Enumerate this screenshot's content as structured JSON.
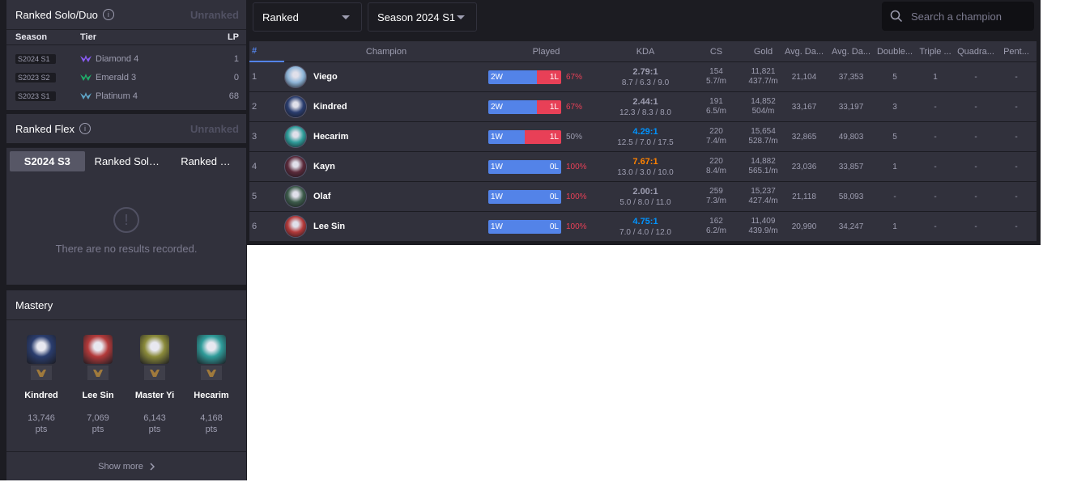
{
  "ranked_solo": {
    "title": "Ranked Solo/Duo",
    "status": "Unranked",
    "headers": {
      "season": "Season",
      "tier": "Tier",
      "lp": "LP"
    },
    "rows": [
      {
        "season": "S2024 S1",
        "tier": "Diamond 4",
        "lp": "1",
        "color": "#8a5cf6"
      },
      {
        "season": "S2023 S2",
        "tier": "Emerald 3",
        "lp": "0",
        "color": "#1fae6a"
      },
      {
        "season": "S2023 S1",
        "tier": "Platinum 4",
        "lp": "68",
        "color": "#5fa6c9"
      }
    ]
  },
  "ranked_flex": {
    "title": "Ranked Flex",
    "status": "Unranked"
  },
  "tabs": {
    "items": [
      "S2024 S3",
      "Ranked Solo/Duo",
      "Ranked Flex"
    ],
    "active_index": 0,
    "empty_icon": "!",
    "empty_text": "There are no results recorded."
  },
  "mastery": {
    "title": "Mastery",
    "items": [
      {
        "name": "Kindred",
        "points": "13,746",
        "unit": "pts",
        "color": "#2a3d6e"
      },
      {
        "name": "Lee Sin",
        "points": "7,069",
        "unit": "pts",
        "color": "#b33a3a"
      },
      {
        "name": "Master Yi",
        "points": "6,143",
        "unit": "pts",
        "color": "#8a8a3a"
      },
      {
        "name": "Hecarim",
        "points": "4,168",
        "unit": "pts",
        "color": "#2f9c9a"
      }
    ],
    "show_more": "Show more"
  },
  "filters": {
    "queue": "Ranked",
    "season": "Season 2024 S1",
    "search_placeholder": "Search a champion"
  },
  "table": {
    "headers": {
      "num": "#",
      "champion": "Champion",
      "played": "Played",
      "kda": "KDA",
      "cs": "CS",
      "gold": "Gold",
      "avg_dmg_dealt": "Avg. Da...",
      "avg_dmg_taken": "Avg. Da...",
      "double": "Double...",
      "triple": "Triple ...",
      "quadra": "Quadra...",
      "penta": "Pent..."
    },
    "rows": [
      {
        "rank": "1",
        "champion": "Viego",
        "icon_color": "#8fb5d8",
        "wins": "2W",
        "losses": "1L",
        "win_frac": 0.67,
        "winrate": "67%",
        "wr_color": "#e84057",
        "kda": "2.79:1",
        "kda_color": "#9e9eb1",
        "kda_detail": "8.7 / 6.3 / 9.0",
        "cs": "154",
        "cs_pm": "5.7/m",
        "gold": "11,821",
        "gold_pm": "437.7/m",
        "dmg_dealt": "21,104",
        "dmg_taken": "37,353",
        "double": "5",
        "triple": "1",
        "quadra": "-",
        "penta": "-"
      },
      {
        "rank": "2",
        "champion": "Kindred",
        "icon_color": "#2a3d6e",
        "wins": "2W",
        "losses": "1L",
        "win_frac": 0.67,
        "winrate": "67%",
        "wr_color": "#e84057",
        "kda": "2.44:1",
        "kda_color": "#9e9eb1",
        "kda_detail": "12.3 / 8.3 / 8.0",
        "cs": "191",
        "cs_pm": "6.5/m",
        "gold": "14,852",
        "gold_pm": "504/m",
        "dmg_dealt": "33,167",
        "dmg_taken": "33,197",
        "double": "3",
        "triple": "-",
        "quadra": "-",
        "penta": "-"
      },
      {
        "rank": "3",
        "champion": "Hecarim",
        "icon_color": "#2f9c9a",
        "wins": "1W",
        "losses": "1L",
        "win_frac": 0.5,
        "winrate": "50%",
        "wr_color": "#9e9eb1",
        "kda": "4.29:1",
        "kda_color": "#0093ff",
        "kda_detail": "12.5 / 7.0 / 17.5",
        "cs": "220",
        "cs_pm": "7.4/m",
        "gold": "15,654",
        "gold_pm": "528.7/m",
        "dmg_dealt": "32,865",
        "dmg_taken": "49,803",
        "double": "5",
        "triple": "-",
        "quadra": "-",
        "penta": "-"
      },
      {
        "rank": "4",
        "champion": "Kayn",
        "icon_color": "#5a2a3a",
        "wins": "1W",
        "losses": "0L",
        "win_frac": 1.0,
        "winrate": "100%",
        "wr_color": "#e84057",
        "kda": "7.67:1",
        "kda_color": "#ff8200",
        "kda_detail": "13.0 / 3.0 / 10.0",
        "cs": "220",
        "cs_pm": "8.4/m",
        "gold": "14,882",
        "gold_pm": "565.1/m",
        "dmg_dealt": "23,036",
        "dmg_taken": "33,857",
        "double": "1",
        "triple": "-",
        "quadra": "-",
        "penta": "-"
      },
      {
        "rank": "5",
        "champion": "Olaf",
        "icon_color": "#3c5a4a",
        "wins": "1W",
        "losses": "0L",
        "win_frac": 1.0,
        "winrate": "100%",
        "wr_color": "#e84057",
        "kda": "2.00:1",
        "kda_color": "#9e9eb1",
        "kda_detail": "5.0 / 8.0 / 11.0",
        "cs": "259",
        "cs_pm": "7.3/m",
        "gold": "15,237",
        "gold_pm": "427.4/m",
        "dmg_dealt": "21,118",
        "dmg_taken": "58,093",
        "double": "-",
        "triple": "-",
        "quadra": "-",
        "penta": "-"
      },
      {
        "rank": "6",
        "champion": "Lee Sin",
        "icon_color": "#b33a3a",
        "wins": "1W",
        "losses": "0L",
        "win_frac": 1.0,
        "winrate": "100%",
        "wr_color": "#e84057",
        "kda": "4.75:1",
        "kda_color": "#0093ff",
        "kda_detail": "7.0 / 4.0 / 12.0",
        "cs": "162",
        "cs_pm": "6.2/m",
        "gold": "11,409",
        "gold_pm": "439.9/m",
        "dmg_dealt": "20,990",
        "dmg_taken": "34,247",
        "double": "1",
        "triple": "-",
        "quadra": "-",
        "penta": "-"
      }
    ]
  }
}
